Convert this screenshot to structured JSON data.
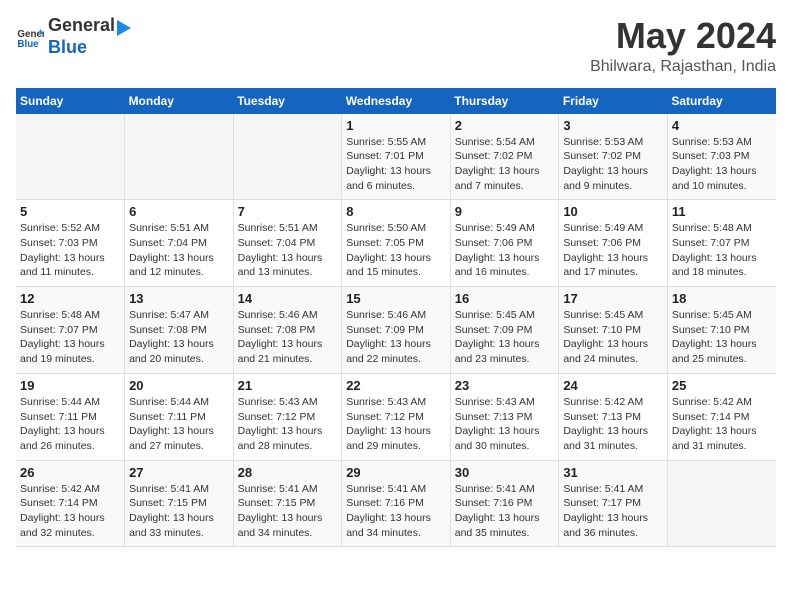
{
  "header": {
    "logo_general": "General",
    "logo_blue": "Blue",
    "title": "May 2024",
    "subtitle": "Bhilwara, Rajasthan, India"
  },
  "columns": [
    "Sunday",
    "Monday",
    "Tuesday",
    "Wednesday",
    "Thursday",
    "Friday",
    "Saturday"
  ],
  "weeks": [
    {
      "days": [
        {
          "number": "",
          "info": ""
        },
        {
          "number": "",
          "info": ""
        },
        {
          "number": "",
          "info": ""
        },
        {
          "number": "1",
          "info": "Sunrise: 5:55 AM\nSunset: 7:01 PM\nDaylight: 13 hours and 6 minutes."
        },
        {
          "number": "2",
          "info": "Sunrise: 5:54 AM\nSunset: 7:02 PM\nDaylight: 13 hours and 7 minutes."
        },
        {
          "number": "3",
          "info": "Sunrise: 5:53 AM\nSunset: 7:02 PM\nDaylight: 13 hours and 9 minutes."
        },
        {
          "number": "4",
          "info": "Sunrise: 5:53 AM\nSunset: 7:03 PM\nDaylight: 13 hours and 10 minutes."
        }
      ]
    },
    {
      "days": [
        {
          "number": "5",
          "info": "Sunrise: 5:52 AM\nSunset: 7:03 PM\nDaylight: 13 hours and 11 minutes."
        },
        {
          "number": "6",
          "info": "Sunrise: 5:51 AM\nSunset: 7:04 PM\nDaylight: 13 hours and 12 minutes."
        },
        {
          "number": "7",
          "info": "Sunrise: 5:51 AM\nSunset: 7:04 PM\nDaylight: 13 hours and 13 minutes."
        },
        {
          "number": "8",
          "info": "Sunrise: 5:50 AM\nSunset: 7:05 PM\nDaylight: 13 hours and 15 minutes."
        },
        {
          "number": "9",
          "info": "Sunrise: 5:49 AM\nSunset: 7:06 PM\nDaylight: 13 hours and 16 minutes."
        },
        {
          "number": "10",
          "info": "Sunrise: 5:49 AM\nSunset: 7:06 PM\nDaylight: 13 hours and 17 minutes."
        },
        {
          "number": "11",
          "info": "Sunrise: 5:48 AM\nSunset: 7:07 PM\nDaylight: 13 hours and 18 minutes."
        }
      ]
    },
    {
      "days": [
        {
          "number": "12",
          "info": "Sunrise: 5:48 AM\nSunset: 7:07 PM\nDaylight: 13 hours and 19 minutes."
        },
        {
          "number": "13",
          "info": "Sunrise: 5:47 AM\nSunset: 7:08 PM\nDaylight: 13 hours and 20 minutes."
        },
        {
          "number": "14",
          "info": "Sunrise: 5:46 AM\nSunset: 7:08 PM\nDaylight: 13 hours and 21 minutes."
        },
        {
          "number": "15",
          "info": "Sunrise: 5:46 AM\nSunset: 7:09 PM\nDaylight: 13 hours and 22 minutes."
        },
        {
          "number": "16",
          "info": "Sunrise: 5:45 AM\nSunset: 7:09 PM\nDaylight: 13 hours and 23 minutes."
        },
        {
          "number": "17",
          "info": "Sunrise: 5:45 AM\nSunset: 7:10 PM\nDaylight: 13 hours and 24 minutes."
        },
        {
          "number": "18",
          "info": "Sunrise: 5:45 AM\nSunset: 7:10 PM\nDaylight: 13 hours and 25 minutes."
        }
      ]
    },
    {
      "days": [
        {
          "number": "19",
          "info": "Sunrise: 5:44 AM\nSunset: 7:11 PM\nDaylight: 13 hours and 26 minutes."
        },
        {
          "number": "20",
          "info": "Sunrise: 5:44 AM\nSunset: 7:11 PM\nDaylight: 13 hours and 27 minutes."
        },
        {
          "number": "21",
          "info": "Sunrise: 5:43 AM\nSunset: 7:12 PM\nDaylight: 13 hours and 28 minutes."
        },
        {
          "number": "22",
          "info": "Sunrise: 5:43 AM\nSunset: 7:12 PM\nDaylight: 13 hours and 29 minutes."
        },
        {
          "number": "23",
          "info": "Sunrise: 5:43 AM\nSunset: 7:13 PM\nDaylight: 13 hours and 30 minutes."
        },
        {
          "number": "24",
          "info": "Sunrise: 5:42 AM\nSunset: 7:13 PM\nDaylight: 13 hours and 31 minutes."
        },
        {
          "number": "25",
          "info": "Sunrise: 5:42 AM\nSunset: 7:14 PM\nDaylight: 13 hours and 31 minutes."
        }
      ]
    },
    {
      "days": [
        {
          "number": "26",
          "info": "Sunrise: 5:42 AM\nSunset: 7:14 PM\nDaylight: 13 hours and 32 minutes."
        },
        {
          "number": "27",
          "info": "Sunrise: 5:41 AM\nSunset: 7:15 PM\nDaylight: 13 hours and 33 minutes."
        },
        {
          "number": "28",
          "info": "Sunrise: 5:41 AM\nSunset: 7:15 PM\nDaylight: 13 hours and 34 minutes."
        },
        {
          "number": "29",
          "info": "Sunrise: 5:41 AM\nSunset: 7:16 PM\nDaylight: 13 hours and 34 minutes."
        },
        {
          "number": "30",
          "info": "Sunrise: 5:41 AM\nSunset: 7:16 PM\nDaylight: 13 hours and 35 minutes."
        },
        {
          "number": "31",
          "info": "Sunrise: 5:41 AM\nSunset: 7:17 PM\nDaylight: 13 hours and 36 minutes."
        },
        {
          "number": "",
          "info": ""
        }
      ]
    }
  ]
}
